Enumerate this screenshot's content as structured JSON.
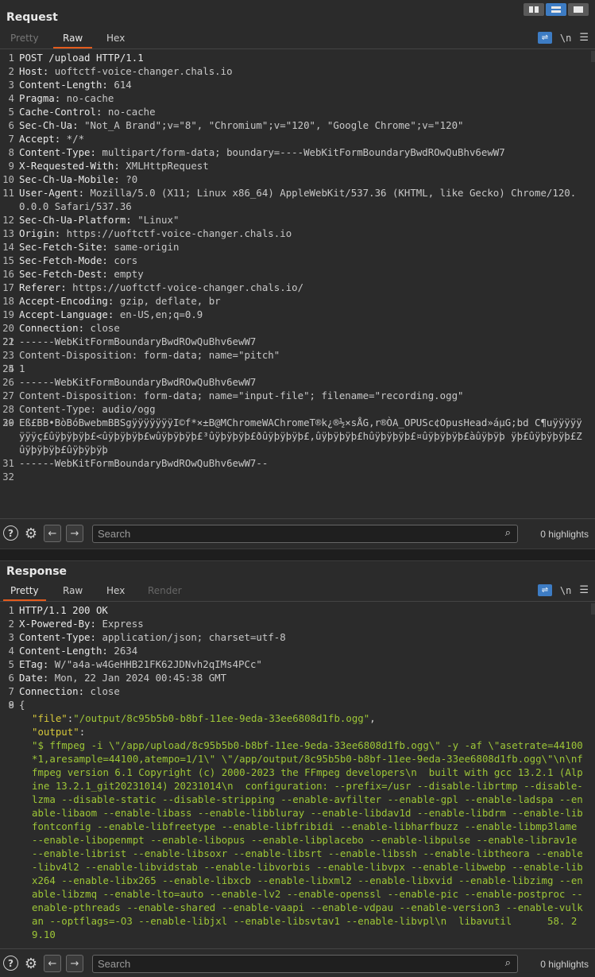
{
  "request": {
    "title": "Request",
    "tabs": [
      "Pretty",
      "Raw",
      "Hex"
    ],
    "active_tab": "Raw",
    "newline_label": "\\n",
    "lines": [
      {
        "n": "1",
        "name": "POST /upload HTTP/1.1",
        "value": ""
      },
      {
        "n": "2",
        "name": "Host:",
        "value": " uoftctf-voice-changer.chals.io"
      },
      {
        "n": "3",
        "name": "Content-Length:",
        "value": " 614"
      },
      {
        "n": "4",
        "name": "Pragma:",
        "value": " no-cache"
      },
      {
        "n": "5",
        "name": "Cache-Control:",
        "value": " no-cache"
      },
      {
        "n": "6",
        "name": "Sec-Ch-Ua:",
        "value": " \"Not_A Brand\";v=\"8\", \"Chromium\";v=\"120\", \"Google Chrome\";v=\"120\""
      },
      {
        "n": "7",
        "name": "Accept:",
        "value": " */*"
      },
      {
        "n": "8",
        "name": "Content-Type:",
        "value": " multipart/form-data; boundary=----WebKitFormBoundaryBwdROwQuBhv6ewW7"
      },
      {
        "n": "9",
        "name": "X-Requested-With:",
        "value": " XMLHttpRequest"
      },
      {
        "n": "10",
        "name": "Sec-Ch-Ua-Mobile:",
        "value": " ?0"
      },
      {
        "n": "11",
        "name": "User-Agent:",
        "value": " Mozilla/5.0 (X11; Linux x86_64) AppleWebKit/537.36 (KHTML, like Gecko) Chrome/120.0.0.0 Safari/537.36"
      },
      {
        "n": "12",
        "name": "Sec-Ch-Ua-Platform:",
        "value": " \"Linux\""
      },
      {
        "n": "13",
        "name": "Origin:",
        "value": " https://uoftctf-voice-changer.chals.io"
      },
      {
        "n": "14",
        "name": "Sec-Fetch-Site:",
        "value": " same-origin"
      },
      {
        "n": "15",
        "name": "Sec-Fetch-Mode:",
        "value": " cors"
      },
      {
        "n": "16",
        "name": "Sec-Fetch-Dest:",
        "value": " empty"
      },
      {
        "n": "17",
        "name": "Referer:",
        "value": " https://uoftctf-voice-changer.chals.io/"
      },
      {
        "n": "18",
        "name": "Accept-Encoding:",
        "value": " gzip, deflate, br"
      },
      {
        "n": "19",
        "name": "Accept-Language:",
        "value": " en-US,en;q=0.9"
      },
      {
        "n": "20",
        "name": "Connection:",
        "value": " close"
      },
      {
        "n": "21",
        "name": "",
        "value": ""
      },
      {
        "n": "22",
        "name": "",
        "value": "------WebKitFormBoundaryBwdROwQuBhv6ewW7"
      },
      {
        "n": "23",
        "name": "",
        "value": "Content-Disposition: form-data; name=\"pitch\""
      },
      {
        "n": "24",
        "name": "",
        "value": ""
      },
      {
        "n": "25",
        "name": "",
        "value": "1"
      },
      {
        "n": "26",
        "name": "",
        "value": "------WebKitFormBoundaryBwdROwQuBhv6ewW7"
      },
      {
        "n": "27",
        "name": "",
        "value": "Content-Disposition: form-data; name=\"input-file\"; filename=\"recording.ogg\""
      },
      {
        "n": "28",
        "name": "",
        "value": "Content-Type: audio/ogg"
      },
      {
        "n": "29",
        "name": "",
        "value": ""
      },
      {
        "n": "30",
        "name": "",
        "value": "Eß£BB•BòBóBwebmBBSgÿÿÿÿÿÿÿI©f*×±B@MChromeWAChromeT®k¿®½×sÅG,r®ÒA_OPUSc¢OpusHead»áµG;bd C¶uÿÿÿÿÿÿÿÿç£ûÿþÿþÿþ£<ûÿþÿþÿþ£wûÿþÿþÿþ£³ûÿþÿþÿþ£ðûÿþÿþÿþ£,ûÿþÿþÿþ£hûÿþÿþÿþ£¤ûÿþÿþÿþ£àûÿþÿþ ÿþ£ûÿþÿþÿþ£Zûÿþÿþÿþ£ûÿþÿþÿþ"
      },
      {
        "n": "31",
        "name": "",
        "value": "------WebKitFormBoundaryBwdROwQuBhv6ewW7--"
      },
      {
        "n": "32",
        "name": "",
        "value": ""
      }
    ],
    "footer": {
      "search_placeholder": "Search",
      "highlights": "0 highlights"
    }
  },
  "response": {
    "title": "Response",
    "tabs": [
      "Pretty",
      "Raw",
      "Hex",
      "Render"
    ],
    "active_tab": "Pretty",
    "newline_label": "\\n",
    "headers": [
      {
        "n": "1",
        "name": "HTTP/1.1 200 OK",
        "value": ""
      },
      {
        "n": "2",
        "name": "X-Powered-By:",
        "value": " Express"
      },
      {
        "n": "3",
        "name": "Content-Type:",
        "value": " application/json; charset=utf-8"
      },
      {
        "n": "4",
        "name": "Content-Length:",
        "value": " 2634"
      },
      {
        "n": "5",
        "name": "ETag:",
        "value": " W/\"a4a-w4GeHHB21FK62JDNvh2qIMs4PCc\""
      },
      {
        "n": "6",
        "name": "Date:",
        "value": " Mon, 22 Jan 2024 00:45:38 GMT"
      },
      {
        "n": "7",
        "name": "Connection:",
        "value": " close"
      },
      {
        "n": "8",
        "name": "",
        "value": ""
      },
      {
        "n": "9",
        "name": "",
        "value": "{"
      }
    ],
    "json_file_key": "\"file\"",
    "json_file_value": "\"/output/8c95b5b0-b8bf-11ee-9eda-33ee6808d1fb.ogg\"",
    "json_output_key": "\"output\"",
    "json_output_value": "\"$ ffmpeg -i \\\"/app/upload/8c95b5b0-b8bf-11ee-9eda-33ee6808d1fb.ogg\\\" -y -af \\\"asetrate=44100*1,aresample=44100,atempo=1/1\\\" \\\"/app/output/8c95b5b0-b8bf-11ee-9eda-33ee6808d1fb.ogg\\\"\\n\\nffmpeg version 6.1 Copyright (c) 2000-2023 the FFmpeg developers\\n  built with gcc 13.2.1 (Alpine 13.2.1_git20231014) 20231014\\n  configuration: --prefix=/usr --disable-librtmp --disable-lzma --disable-static --disable-stripping --enable-avfilter --enable-gpl --enable-ladspa --enable-libaom --enable-libass --enable-libbluray --enable-libdav1d --enable-libdrm --enable-libfontconfig --enable-libfreetype --enable-libfribidi --enable-libharfbuzz --enable-libmp3lame --enable-libopenmpt --enable-libopus --enable-libplacebo --enable-libpulse --enable-librav1e --enable-librist --enable-libsoxr --enable-libsrt --enable-libssh --enable-libtheora --enable-libv4l2 --enable-libvidstab --enable-libvorbis --enable-libvpx --enable-libwebp --enable-libx264 --enable-libx265 --enable-libxcb --enable-libxml2 --enable-libxvid --enable-libzimg --enable-libzmq --enable-lto=auto --enable-lv2 --enable-openssl --enable-pic --enable-postproc --enable-pthreads --enable-shared --enable-vaapi --enable-vdpau --enable-version3 --enable-vulkan --optflags=-O3 --enable-libjxl --enable-libsvtav1 --enable-libvpl\\n  libavutil      58. 29.10",
    "footer": {
      "search_placeholder": "Search",
      "highlights": "0 highlights"
    }
  },
  "colors": {
    "accent": "#e35b1d",
    "toolbar_active": "#3d7cc4",
    "json_key": "#d6c83a",
    "json_string": "#9ec737"
  }
}
